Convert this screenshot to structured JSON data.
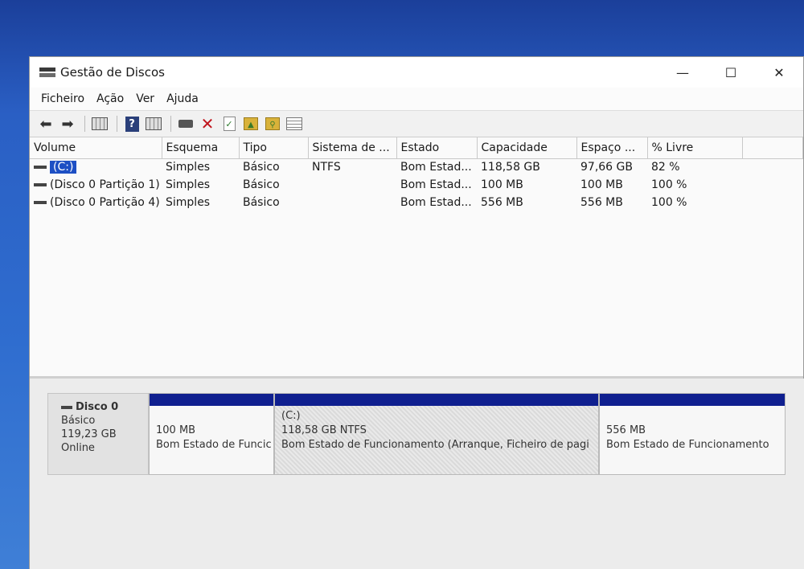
{
  "window": {
    "title": "Gestão de Discos",
    "controls": {
      "minimize": "—",
      "maximize": "☐",
      "close": "✕"
    }
  },
  "menu": [
    "Ficheiro",
    "Ação",
    "Ver",
    "Ajuda"
  ],
  "toolbar": {
    "icons": [
      "back-icon",
      "forward-icon",
      "console-tree-icon",
      "help-icon",
      "properties-icon",
      "connect-disk-icon",
      "delete-icon",
      "check-icon",
      "folder-up-icon",
      "folder-search-icon",
      "list-view-icon"
    ]
  },
  "volumes": {
    "columns": [
      "Volume",
      "Esquema",
      "Tipo",
      "Sistema de ...",
      "Estado",
      "Capacidade",
      "Espaço ...",
      "% Livre"
    ],
    "rows": [
      [
        "(C:)",
        "Simples",
        "Básico",
        "NTFS",
        "Bom Estad...",
        "118,58 GB",
        "97,66 GB",
        "82 %"
      ],
      [
        "(Disco 0 Partição 1)",
        "Simples",
        "Básico",
        "",
        "Bom Estad...",
        "100 MB",
        "100 MB",
        "100 %"
      ],
      [
        "(Disco 0 Partição 4)",
        "Simples",
        "Básico",
        "",
        "Bom Estad...",
        "556 MB",
        "556 MB",
        "100 %"
      ]
    ]
  },
  "disk": {
    "name": "Disco 0",
    "type": "Básico",
    "size": "119,23 GB",
    "status": "Online",
    "partitions": [
      {
        "title": "",
        "size": "100 MB",
        "status": "Bom Estado de Funcic"
      },
      {
        "title": "(C:)",
        "size": "118,58 GB NTFS",
        "status": "Bom Estado de Funcionamento (Arranque, Ficheiro de pagi"
      },
      {
        "title": "",
        "size": "556 MB",
        "status": "Bom Estado de Funcionamento"
      }
    ]
  },
  "colors": {
    "partition_header": "#0f1f8f",
    "selection": "#1d4fc4"
  }
}
